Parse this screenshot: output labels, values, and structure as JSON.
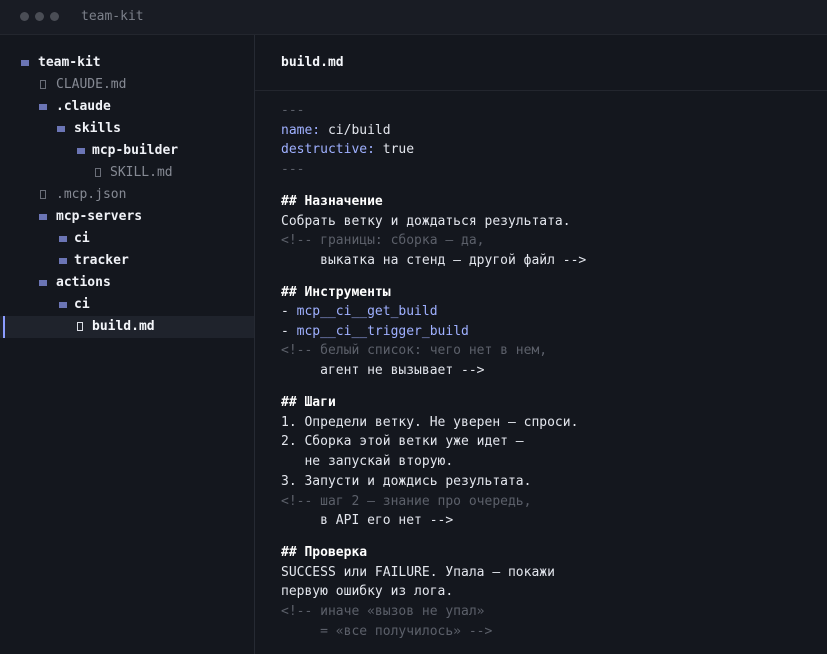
{
  "window": {
    "title": "team-kit"
  },
  "tree": [
    {
      "kind": "folder",
      "label": "team-kit"
    },
    {
      "kind": "file",
      "label": "CLAUDE.md"
    },
    {
      "kind": "folder",
      "label": ".claude"
    },
    {
      "kind": "folder",
      "label": "skills"
    },
    {
      "kind": "folder",
      "label": "mcp-builder"
    },
    {
      "kind": "file",
      "label": "SKILL.md"
    },
    {
      "kind": "file",
      "label": ".mcp.json"
    },
    {
      "kind": "folder",
      "label": "mcp-servers"
    },
    {
      "kind": "folder",
      "label": "ci"
    },
    {
      "kind": "folder",
      "label": "tracker"
    },
    {
      "kind": "folder",
      "label": "actions"
    },
    {
      "kind": "folder",
      "label": "ci"
    },
    {
      "kind": "file",
      "label": "build.md",
      "active": true
    }
  ],
  "editor": {
    "filename": "build.md",
    "frontmatter": {
      "sep": "---",
      "name_key": "name:",
      "name_val": " ci/build",
      "destructive_key": "destructive:",
      "destructive_val": " true"
    },
    "sections": {
      "purpose": {
        "heading": "## Назначение",
        "text": "Собрать ветку и дождаться результата.",
        "comment1": "<!-- границы: сборка — да,",
        "comment2": "     выкатка на стенд — другой файл -->"
      },
      "tools": {
        "heading": "## Инструменты",
        "dash1": "- ",
        "tool1": "mcp__ci__get_build",
        "dash2": "- ",
        "tool2": "mcp__ci__trigger_build",
        "comment1": "<!-- белый список: чего нет в нем,",
        "comment2": "     агент не вызывает -->"
      },
      "steps": {
        "heading": "## Шаги",
        "s1": "1. Определи ветку. Не уверен — спроси.",
        "s2a": "2. Сборка этой ветки уже идет —",
        "s2b": "   не запускай вторую.",
        "s3": "3. Запусти и дождись результата.",
        "comment1": "<!-- шаг 2 — знание про очередь,",
        "comment2": "     в API его нет -->"
      },
      "check": {
        "heading": "## Проверка",
        "t1": "SUCCESS или FAILURE. Упала — покажи",
        "t2": "первую ошибку из лога.",
        "comment1": "<!-- иначе «вызов не упал»",
        "comment2": "     = «все получилось» -->"
      }
    }
  }
}
